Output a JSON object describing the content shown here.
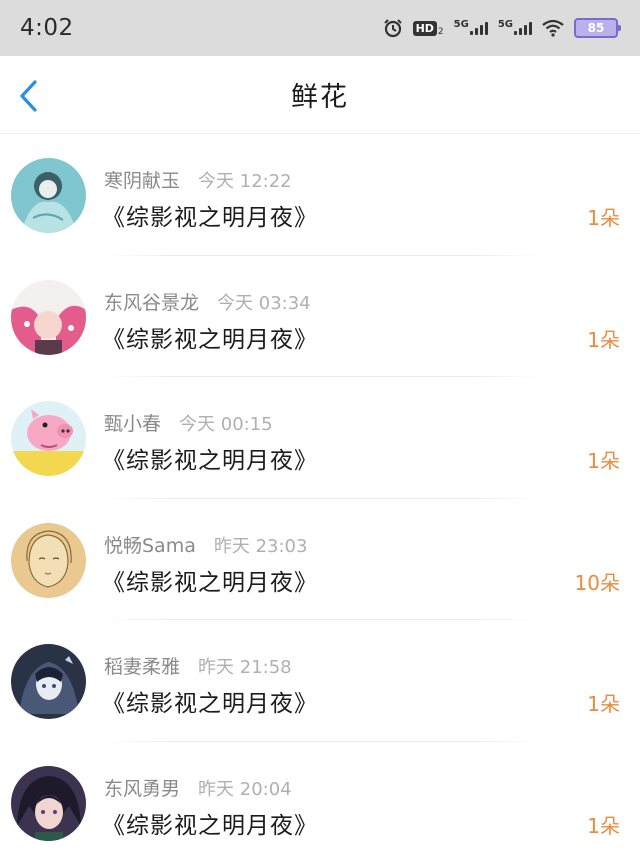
{
  "status_bar": {
    "time": "4:02",
    "hd_label": "HD",
    "hd_sub": "2",
    "net1": "5G",
    "net2": "5G",
    "battery": "85",
    "icons": [
      "alarm-icon",
      "hd-volte-icon",
      "signal-5g-icon",
      "signal-5g-icon",
      "wifi-icon",
      "battery-icon"
    ]
  },
  "header": {
    "title": "鲜花",
    "back_icon": "chevron-left-icon"
  },
  "colors": {
    "status_bar_bg": "#dcdcdc",
    "accent_back": "#2b8fe0",
    "count_orange": "#ef8a3c",
    "battery": "#b9b0ec"
  },
  "items": [
    {
      "name": "寒阴献玉",
      "time": "今天 12:22",
      "book": "《综影视之明月夜》",
      "count": "1朵"
    },
    {
      "name": "东风谷景龙",
      "time": "今天 03:34",
      "book": "《综影视之明月夜》",
      "count": "1朵"
    },
    {
      "name": "甄小春",
      "time": "今天 00:15",
      "book": "《综影视之明月夜》",
      "count": "1朵"
    },
    {
      "name": "悦畅Sama",
      "time": "昨天 23:03",
      "book": "《综影视之明月夜》",
      "count": "10朵"
    },
    {
      "name": "稻妻柔雅",
      "time": "昨天 21:58",
      "book": "《综影视之明月夜》",
      "count": "1朵"
    },
    {
      "name": "东风勇男",
      "time": "昨天 20:04",
      "book": "《综影视之明月夜》",
      "count": "1朵"
    }
  ]
}
